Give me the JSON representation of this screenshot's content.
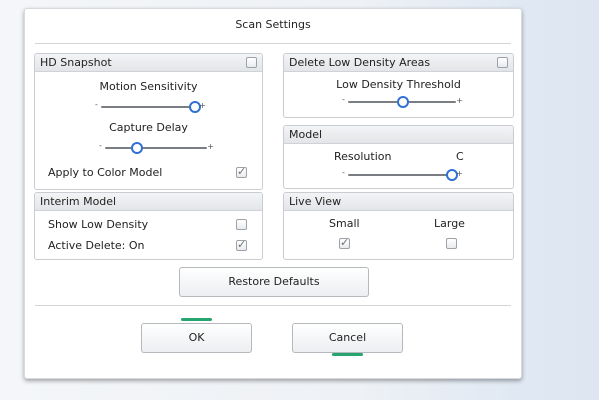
{
  "dialog": {
    "title": "Scan Settings"
  },
  "hd_snapshot": {
    "title": "HD Snapshot",
    "enabled": false,
    "motion_sensitivity": {
      "label": "Motion Sensitivity",
      "value": 0.95
    },
    "capture_delay": {
      "label": "Capture Delay",
      "value": 0.3
    },
    "apply_to_color_model": {
      "label": "Apply to Color Model",
      "checked": true
    }
  },
  "delete_low_density": {
    "title": "Delete Low Density Areas",
    "enabled": false,
    "threshold": {
      "label": "Low Density Threshold",
      "value": 0.5
    }
  },
  "model": {
    "title": "Model",
    "resolution": {
      "label": "Resolution",
      "value_text": "C",
      "value": 0.95
    }
  },
  "interim_model": {
    "title": "Interim Model",
    "show_low_density": {
      "label": "Show Low Density",
      "checked": false
    },
    "active_delete": {
      "label": "Active Delete: On",
      "checked": true
    }
  },
  "live_view": {
    "title": "Live View",
    "small": {
      "label": "Small",
      "checked": true
    },
    "large": {
      "label": "Large",
      "checked": false
    }
  },
  "buttons": {
    "restore_defaults": "Restore Defaults",
    "ok": "OK",
    "cancel": "Cancel"
  },
  "colors": {
    "accent": "#2f6fd6",
    "focus": "#27a56f"
  },
  "slider_symbols": {
    "minus": "-",
    "plus": "+"
  }
}
